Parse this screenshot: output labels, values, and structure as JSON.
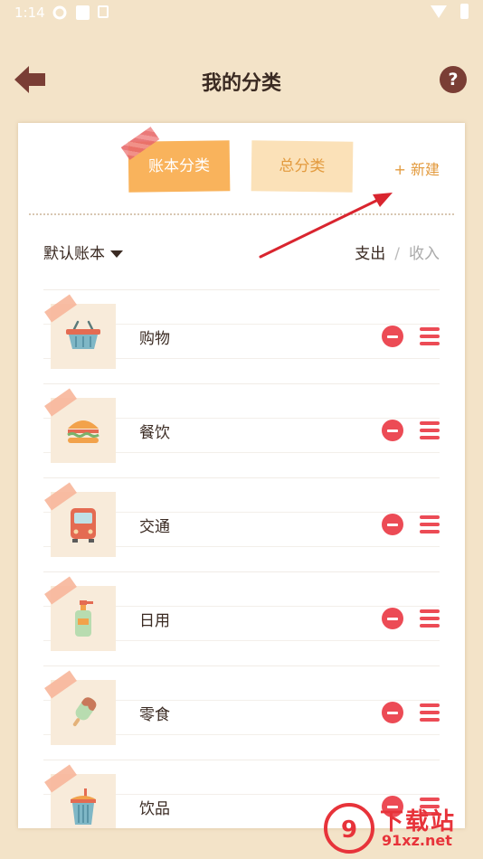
{
  "status_bar": {
    "time": "1:14"
  },
  "header": {
    "title": "我的分类",
    "help_label": "?"
  },
  "tabs": [
    {
      "label": "账本分类",
      "active": true
    },
    {
      "label": "总分类",
      "active": false
    }
  ],
  "new_button": "+ 新建",
  "book_selector": {
    "label": "默认账本"
  },
  "type_toggle": {
    "expense": "支出",
    "separator": "/",
    "income": "收入",
    "selected": "expense"
  },
  "categories": [
    {
      "name": "购物",
      "icon": "shopping-basket-icon"
    },
    {
      "name": "餐饮",
      "icon": "burger-icon"
    },
    {
      "name": "交通",
      "icon": "bus-icon"
    },
    {
      "name": "日用",
      "icon": "soap-bottle-icon"
    },
    {
      "name": "零食",
      "icon": "popsicle-icon"
    },
    {
      "name": "饮品",
      "icon": "drink-cup-icon"
    }
  ],
  "watermark": {
    "text": "下载站",
    "domain": "91xz.net"
  },
  "colors": {
    "accent": "#f9b35c",
    "accent_text": "#e39b3f",
    "delete": "#ec4b55",
    "background": "#f3e3c8",
    "header_icon": "#7a3e35"
  }
}
